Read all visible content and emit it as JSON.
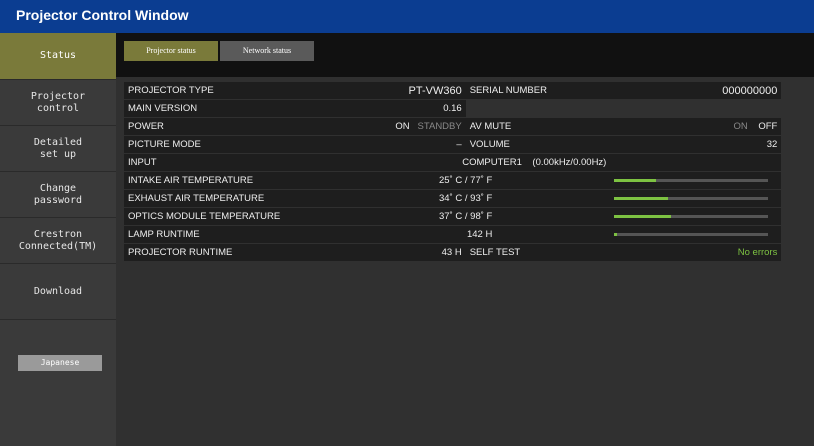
{
  "window": {
    "title": "Projector Control Window"
  },
  "sidebar": {
    "items": [
      {
        "label": "Status"
      },
      {
        "label": "Projector\ncontrol"
      },
      {
        "label": "Detailed\nset up"
      },
      {
        "label": "Change\npassword"
      },
      {
        "label": "Crestron\nConnected(TM)"
      },
      {
        "label": "Download"
      }
    ],
    "language_button": "Japanese"
  },
  "tabs": [
    {
      "label": "Projector status"
    },
    {
      "label": "Network status"
    }
  ],
  "status": {
    "projector_type_label": "PROJECTOR TYPE",
    "projector_type": "PT-VW360",
    "serial_label": "SERIAL NUMBER",
    "serial": "000000000",
    "main_version_label": "MAIN VERSION",
    "main_version": "0.16",
    "power_label": "POWER",
    "power_on": "ON",
    "power_standby": "STANDBY",
    "av_mute_label": "AV MUTE",
    "av_mute_on": "ON",
    "av_mute_off": "OFF",
    "picture_mode_label": "PICTURE MODE",
    "picture_mode": "–",
    "volume_label": "VOLUME",
    "volume": "32",
    "input_label": "INPUT",
    "input": "COMPUTER1",
    "input_freq": "(0.00kHz/0.00Hz)",
    "intake_label": "INTAKE AIR TEMPERATURE",
    "intake": "25˚ C / 77˚ F",
    "intake_level": 0.27,
    "exhaust_label": "EXHAUST AIR TEMPERATURE",
    "exhaust": "34˚ C / 93˚ F",
    "exhaust_level": 0.35,
    "optics_label": "OPTICS MODULE TEMPERATURE",
    "optics": "37˚ C / 98˚ F",
    "optics_level": 0.37,
    "lamp_label": "LAMP RUNTIME",
    "lamp": "142 H",
    "lamp_level": 0.02,
    "projector_runtime_label": "PROJECTOR RUNTIME",
    "projector_runtime": "43 H",
    "self_test_label": "SELF TEST",
    "self_test": "No errors"
  },
  "colors": {
    "title_bar": "#0b3d91",
    "active": "#7a7a3a",
    "ok_green": "#7dc242"
  }
}
